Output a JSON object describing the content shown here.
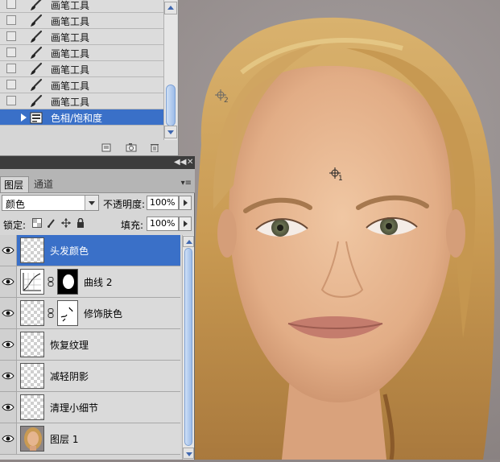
{
  "history_panel": {
    "steps": [
      {
        "label": "画笔工具",
        "icon": "brush-icon",
        "active": false
      },
      {
        "label": "画笔工具",
        "icon": "brush-icon",
        "active": false
      },
      {
        "label": "画笔工具",
        "icon": "brush-icon",
        "active": false
      },
      {
        "label": "画笔工具",
        "icon": "brush-icon",
        "active": false
      },
      {
        "label": "画笔工具",
        "icon": "brush-icon",
        "active": false
      },
      {
        "label": "画笔工具",
        "icon": "brush-icon",
        "active": false
      },
      {
        "label": "画笔工具",
        "icon": "brush-icon",
        "active": false
      },
      {
        "label": "色相/饱和度",
        "icon": "adjustment-layer-icon",
        "active": true
      }
    ],
    "footer_icons": [
      "new-document-from-state-icon",
      "snapshot-camera-icon",
      "trash-icon"
    ]
  },
  "layers_panel": {
    "tabs": [
      {
        "label": "图层",
        "active": true
      },
      {
        "label": "通道",
        "active": false
      }
    ],
    "blend_mode": "颜色",
    "opacity_label": "不透明度:",
    "opacity_value": "100%",
    "lock_label": "锁定:",
    "fill_label": "填充:",
    "fill_value": "100%",
    "layers": [
      {
        "name": "头发颜色",
        "thumb": "transparent",
        "visible": true,
        "active": true,
        "mask": false
      },
      {
        "name": "曲线 2",
        "thumb": "curves-adjustment",
        "visible": true,
        "active": false,
        "mask": true
      },
      {
        "name": "修饰肤色",
        "thumb": "transparent",
        "visible": true,
        "active": false,
        "mask": true
      },
      {
        "name": "恢复纹理",
        "thumb": "transparent",
        "visible": true,
        "active": false,
        "mask": false
      },
      {
        "name": "减轻阴影",
        "thumb": "transparent",
        "visible": true,
        "active": false,
        "mask": false
      },
      {
        "name": "清理小细节",
        "thumb": "transparent",
        "visible": true,
        "active": false,
        "mask": false
      },
      {
        "name": "图层 1",
        "thumb": "portrait-photo",
        "visible": true,
        "active": false,
        "mask": false
      }
    ]
  },
  "canvas": {
    "image": "portrait-photo",
    "color_samplers": [
      {
        "label": "1",
        "icon": "color-sampler-icon"
      },
      {
        "label": "2",
        "icon": "color-sampler-icon"
      }
    ]
  },
  "colors": {
    "selection": "#3a70c8",
    "panel_bg": "#d6d6d6",
    "canvas_bg": "#8d8686"
  }
}
